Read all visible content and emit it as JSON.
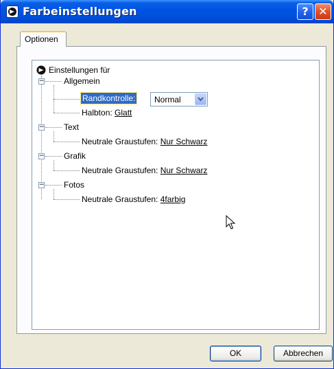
{
  "window": {
    "title": "Farbeinstellungen",
    "help_glyph": "?",
    "close_glyph": "✕"
  },
  "tabs": [
    {
      "label": "Optionen",
      "active": true
    }
  ],
  "tree": {
    "root_label": "Einstellungen für",
    "groups": [
      {
        "label": "Allgemein",
        "expander": "−",
        "items": [
          {
            "label": "Randkontrolle:",
            "value": "Normal",
            "selected": true,
            "control": "dropdown"
          },
          {
            "label": "Halbton:",
            "value": "Glatt"
          }
        ]
      },
      {
        "label": "Text",
        "expander": "−",
        "items": [
          {
            "label": "Neutrale Graustufen:",
            "value": "Nur Schwarz"
          }
        ]
      },
      {
        "label": "Grafik",
        "expander": "−",
        "items": [
          {
            "label": "Neutrale Graustufen:",
            "value": "Nur Schwarz"
          }
        ]
      },
      {
        "label": "Fotos",
        "expander": "−",
        "items": [
          {
            "label": "Neutrale Graustufen:",
            "value": "4farbig"
          }
        ]
      }
    ]
  },
  "buttons": {
    "ok": "OK",
    "cancel": "Abbrechen"
  },
  "colors": {
    "titlebar": "#0054e3",
    "selection": "#316ac5",
    "tab_highlight": "#ffc83c",
    "dialog_bg": "#ece9d8"
  }
}
